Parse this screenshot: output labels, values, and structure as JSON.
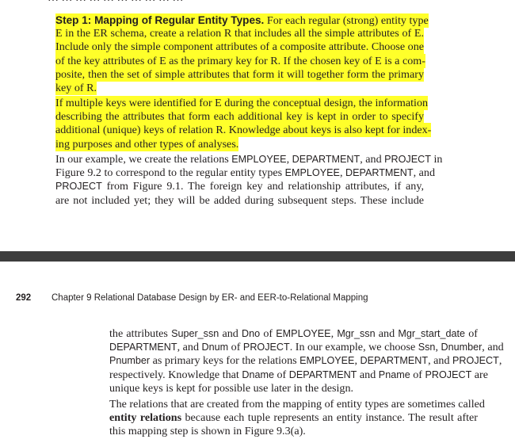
{
  "top_page": {
    "cut_text": "…   …           …   …   …   …   …   …  …          …",
    "step_heading": "Step 1: Mapping of Regular Entity Types.",
    "para1_lines": [
      " For each regular (strong) entity type",
      "E in the ER schema, create a relation R that includes all the simple attributes of E.",
      "Include only the simple component attributes of a composite attribute. Choose one",
      "of the key attributes of E as the primary key for R. If the chosen key of E is a com-",
      "posite, then the set of simple attributes that form it will together form the primary",
      "key of R."
    ],
    "para2_lines": [
      "If multiple keys were identified for E during the conceptual design, the information",
      "describing the attributes that form each additional key is kept in order to specify",
      "additional (unique) keys of relation R. Knowledge about keys is also kept for index-",
      "ing purposes and other types of analyses."
    ],
    "para3_lines": [
      [
        "In our example, we create the relations ",
        "EMPLOYEE",
        ", ",
        "DEPARTMENT",
        ", and ",
        "PROJECT",
        " in"
      ],
      [
        "Figure 9.2 to correspond to the regular entity types ",
        "EMPLOYEE",
        ", ",
        "DEPARTMENT",
        ", and"
      ],
      [
        "PROJECT",
        " from Figure 9.1. The foreign key and relationship attributes, if any,"
      ],
      [
        "are not included yet; they will be added during subsequent steps. These include"
      ]
    ]
  },
  "bottom_page": {
    "page_number": "292",
    "running_head": "Chapter 9  Relational Database Design by ER- and EER-to-Relational Mapping",
    "para1_lines": [
      [
        "the attributes ",
        "Super_ssn",
        " and ",
        "Dno",
        " of ",
        "EMPLOYEE",
        ", ",
        "Mgr_ssn",
        " and ",
        "Mgr_start_date",
        " of"
      ],
      [
        "DEPARTMENT",
        ", and ",
        "Dnum",
        " of ",
        "PROJECT",
        ". In our example, we choose ",
        "Ssn",
        ", ",
        "Dnumber",
        ", and"
      ],
      [
        "Pnumber",
        " as primary keys for the relations ",
        "EMPLOYEE",
        ", ",
        "DEPARTMENT",
        ", and ",
        "PROJECT",
        ","
      ],
      [
        "respectively. Knowledge that ",
        "Dname",
        " of ",
        "DEPARTMENT",
        " and ",
        "Pname",
        " of ",
        "PROJECT",
        " are"
      ],
      [
        "unique keys is kept for possible use later in the design."
      ]
    ],
    "para2_lines": [
      "The relations that are created from the mapping of entity types are sometimes called",
      "entity relations",
      " because each tuple represents an entity instance. The result after",
      "this mapping step is shown in Figure 9.3(a)."
    ]
  },
  "colors": {
    "highlight": "#ffff2a",
    "divider": "#3d3d3d",
    "text": "#231f20"
  }
}
